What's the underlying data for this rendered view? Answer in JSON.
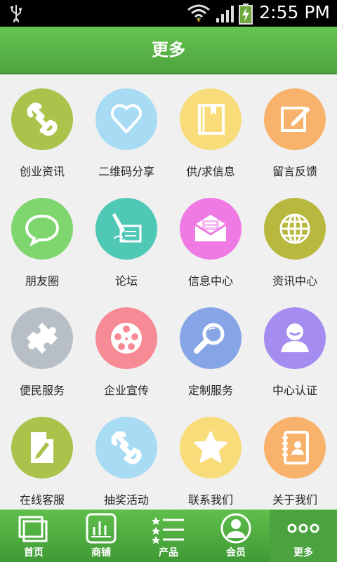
{
  "status_bar": {
    "time": "2:55 PM"
  },
  "header": {
    "title": "更多"
  },
  "grid": [
    {
      "label": "创业资讯",
      "icon": "link-icon",
      "color": "#a9c34b"
    },
    {
      "label": "二维码分享",
      "icon": "heart-icon",
      "color": "#a8dcf5"
    },
    {
      "label": "供/求信息",
      "icon": "book-icon",
      "color": "#f8dc7a"
    },
    {
      "label": "留言反馈",
      "icon": "edit-icon",
      "color": "#f8b26b"
    },
    {
      "label": "朋友圈",
      "icon": "chat-bubble-icon",
      "color": "#7fd66f"
    },
    {
      "label": "论坛",
      "icon": "forum-pen-icon",
      "color": "#4fc8b6"
    },
    {
      "label": "信息中心",
      "icon": "mail-icon",
      "color": "#f07ae3"
    },
    {
      "label": "资讯中心",
      "icon": "globe-icon",
      "color": "#b8b83e"
    },
    {
      "label": "便民服务",
      "icon": "puzzle-icon",
      "color": "#b8bec6"
    },
    {
      "label": "企业宣传",
      "icon": "film-reel-icon",
      "color": "#f68b95"
    },
    {
      "label": "定制服务",
      "icon": "magnifier-icon",
      "color": "#86a5e6"
    },
    {
      "label": "中心认证",
      "icon": "user-icon",
      "color": "#a58cf0"
    },
    {
      "label": "在线客服",
      "icon": "document-pen-icon",
      "color": "#a9c34b"
    },
    {
      "label": "抽奖活动",
      "icon": "link-icon",
      "color": "#a8dcf5"
    },
    {
      "label": "联系我们",
      "icon": "star-icon",
      "color": "#f8dc7a"
    },
    {
      "label": "关于我们",
      "icon": "contact-book-icon",
      "color": "#f8b26b"
    }
  ],
  "tabs": [
    {
      "label": "首页",
      "icon": "home-windows-icon",
      "active": false
    },
    {
      "label": "商铺",
      "icon": "shop-bars-icon",
      "active": false
    },
    {
      "label": "产品",
      "icon": "star-list-icon",
      "active": false
    },
    {
      "label": "会员",
      "icon": "member-icon",
      "active": false
    },
    {
      "label": "更多",
      "icon": "more-dots-icon",
      "active": true
    }
  ]
}
